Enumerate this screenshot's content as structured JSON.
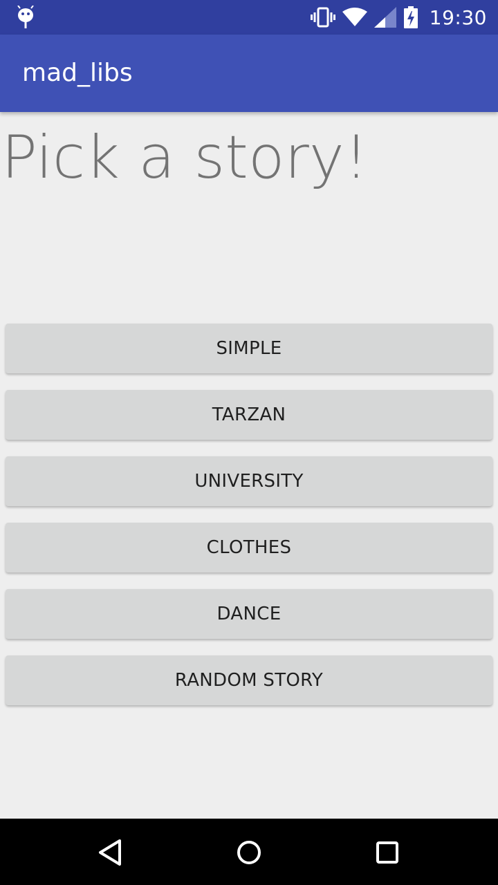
{
  "status_bar": {
    "time": "19:30",
    "icons": [
      "android-debug-icon",
      "vibrate-icon",
      "wifi-icon",
      "signal-icon",
      "battery-charging-icon"
    ]
  },
  "app_bar": {
    "title": "mad_libs"
  },
  "main": {
    "headline": "Pick a story!",
    "buttons": [
      {
        "label": "SIMPLE"
      },
      {
        "label": "TARZAN"
      },
      {
        "label": "UNIVERSITY"
      },
      {
        "label": "CLOTHES"
      },
      {
        "label": "DANCE"
      },
      {
        "label": "RANDOM STORY"
      }
    ]
  },
  "nav_bar": {
    "icons": [
      "back-icon",
      "home-icon",
      "recents-icon"
    ]
  },
  "colors": {
    "status_bar": "#303f9f",
    "app_bar": "#3f51b5",
    "background": "#eeeeee",
    "button": "#d6d7d7"
  }
}
